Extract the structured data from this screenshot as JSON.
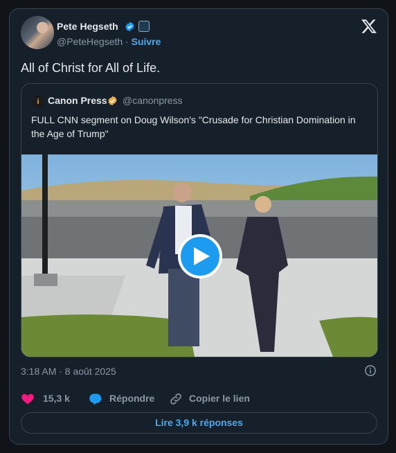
{
  "author": {
    "name": "Pete Hegseth",
    "handle": "@PeteHegseth",
    "separator": "·",
    "follow_label": "Suivre"
  },
  "tweet": {
    "text": "All of Christ for All of Life.",
    "timestamp": "3:18 AM · 8 août 2025"
  },
  "quoted": {
    "avatar_letter": "i",
    "name": "Canon Press",
    "handle": "@canonpress",
    "text": "FULL CNN segment on Doug Wilson's \"Crusade for Christian Domination in the Age of Trump\""
  },
  "actions": {
    "likes": "15,3 k",
    "reply_label": "Répondre",
    "copy_label": "Copier le lien"
  },
  "read_replies_label": "Lire 3,9 k réponses",
  "colors": {
    "accent": "#1d9bf0",
    "like": "#f91880",
    "verified": "#1d9bf0",
    "gold": "#e8b04a"
  }
}
